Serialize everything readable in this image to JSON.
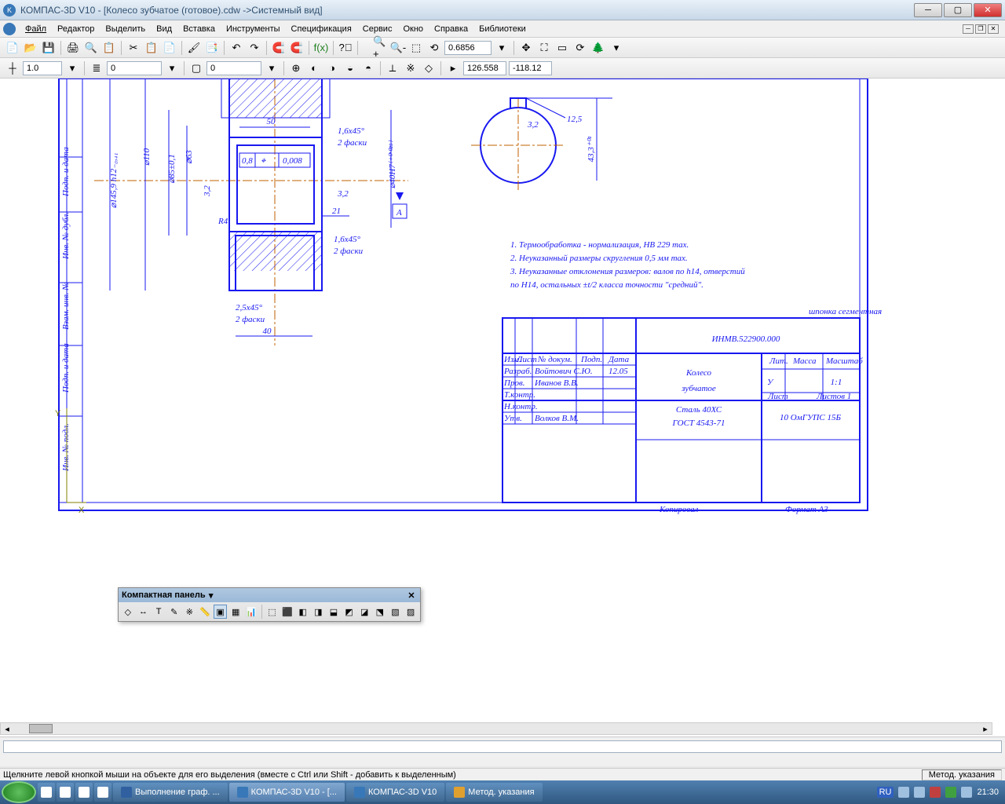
{
  "window": {
    "title": "КОМПАС-3D V10 - [Колесо зубчатое (готовое).cdw ->Системный вид]"
  },
  "menu": {
    "file": "Файл",
    "editor": "Редактор",
    "select": "Выделить",
    "view": "Вид",
    "insert": "Вставка",
    "tools": "Инструменты",
    "spec": "Спецификация",
    "service": "Сервис",
    "window": "Окно",
    "help": "Справка",
    "libs": "Библиотеки"
  },
  "tb2": {
    "zoom": "0.6856"
  },
  "tb3": {
    "val1": "1.0",
    "val2": "0",
    "coordx": "126.558",
    "coordy": "-118.12"
  },
  "compact": {
    "title": "Компактная панель"
  },
  "status": {
    "hint": "Щелкните левой кнопкой мыши на объекте для его выделения (вместе с Ctrl или Shift - добавить к выделенным)",
    "right": "Метод. указания"
  },
  "taskbar": {
    "item1": "Выполнение граф. ...",
    "item2": "КОМПАС-3D V10 - [...",
    "item3": "КОМПАС-3D V10",
    "item4": "Метод. указания",
    "lang": "RU",
    "time": "21:30"
  },
  "drawing": {
    "dim50": "50",
    "dimR4": "R4",
    "dim08": "0,8",
    "dim0008": "0,008",
    "dim32a": "3,2",
    "dim32b": "3,2",
    "dim21": "21",
    "dim16x45a": "1,6x45°",
    "faski2a": "2 фаски",
    "dim16x45b": "1,6x45°",
    "faski2b": "2 фаски",
    "dim25x45": "2,5x45°",
    "faski2c": "2 фаски",
    "dim40": "40",
    "diam145": "⌀145,9 h12₋₀,₄₁",
    "diam85": "⌀85±0,1",
    "diam63": "⌀63",
    "diam110": "⌀110",
    "diam40": "⌀40H7⁽⁺⁰'⁰²⁵⁾",
    "letterA": "А",
    "dim125": "12,5",
    "dim32c": "3,2",
    "dim433": "43,3⁺⁰¹",
    "note1": "1. Термообработка - нормализация, HB 229 max.",
    "note2": "2. Неуказанный размеры скругления 0,5 мм max.",
    "note3": "3. Неуказанные отклонения размеров: валов по h14, отверстий",
    "note3b": "   по H14, остальных ±t/2 класса точности \"средний\".",
    "tlabel": "шпонка сегментная",
    "stamp": {
      "code": "ИНМВ.522900.000",
      "name1": "Колесо",
      "name2": "зубчатое",
      "mat": "Сталь 40ХС",
      "gost": "ГОСТ 4543-71",
      "scale": "1:1",
      "org": "10 ОмГУПС 15Б",
      "izm": "Изм.",
      "list": "Лист",
      "doc": "№ докум.",
      "podp": "Подп.",
      "data": "Дата",
      "razrab": "Разраб.",
      "razrabn": "Войтович С.Ю.",
      "razrabd": "12.05",
      "prov": "Пров.",
      "provn": "Иванов В.В.",
      "tkontr": "Т.контр.",
      "nkontr": "Н.контр.",
      "utv": "Утв.",
      "utvn": "Волков В.М.",
      "lit": "Лит.",
      "massa": "Масса",
      "masht": "Масштаб",
      "listh": "Лист",
      "listov": "Листов    1",
      "letu": "У",
      "kopir": "Копировал",
      "format": "Формат    A3"
    },
    "side": {
      "l1": "Подп. и дата",
      "l2": "Инв. № дубл.",
      "l3": "Взам. инв. №",
      "l4": "Подп. и дата",
      "l5": "Инв. № подл."
    }
  }
}
